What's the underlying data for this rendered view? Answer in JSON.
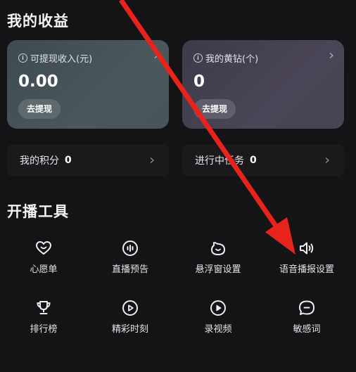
{
  "earnings": {
    "title": "我的收益",
    "income_card": {
      "label": "可提现收入(元)",
      "value": "0.00",
      "button": "去提现"
    },
    "diamond_card": {
      "label": "我的黄钻(个)",
      "value": "0",
      "button": "去提现"
    },
    "points_row": {
      "label": "我的积分",
      "value": "0"
    },
    "tasks_row": {
      "label": "进行中任务",
      "value": "0"
    }
  },
  "tools": {
    "title": "开播工具",
    "items": [
      {
        "label": "心愿单",
        "icon": "heart-icon"
      },
      {
        "label": "直播预告",
        "icon": "live-preview-icon"
      },
      {
        "label": "悬浮窗设置",
        "icon": "float-window-icon"
      },
      {
        "label": "语音播报设置",
        "icon": "speaker-icon"
      },
      {
        "label": "排行榜",
        "icon": "trophy-icon"
      },
      {
        "label": "精彩时刻",
        "icon": "play-icon"
      },
      {
        "label": "录视频",
        "icon": "record-video-icon"
      },
      {
        "label": "敏感词",
        "icon": "chat-icon"
      }
    ]
  },
  "colors": {
    "background": "#141416",
    "income_card": "#4a585d",
    "diamond_card": "#4a4556",
    "annotation_arrow": "#e8231b"
  }
}
